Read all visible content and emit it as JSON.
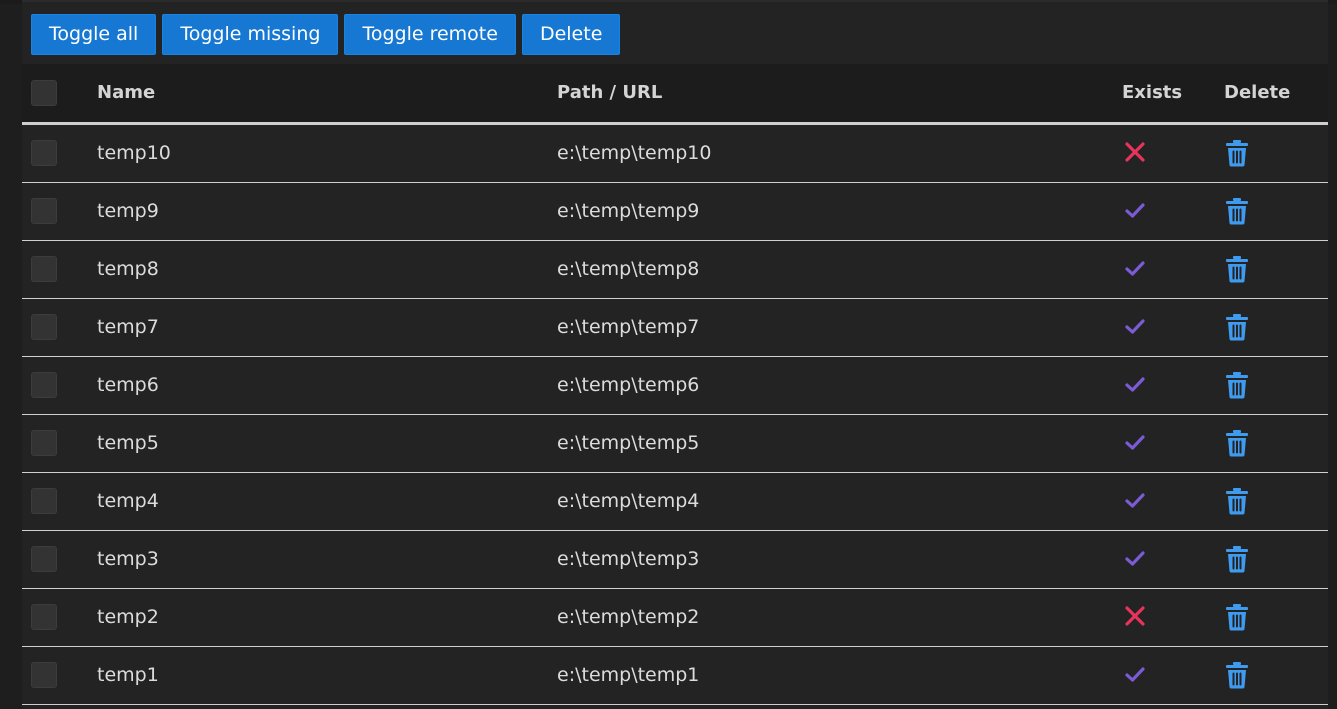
{
  "toolbar": {
    "buttons": [
      {
        "label": "Toggle all"
      },
      {
        "label": "Toggle missing"
      },
      {
        "label": "Toggle remote"
      },
      {
        "label": "Delete"
      }
    ]
  },
  "table": {
    "columns": {
      "name": "Name",
      "path": "Path / URL",
      "exists": "Exists",
      "delete": "Delete"
    },
    "rows": [
      {
        "name": "temp10",
        "path": "e:\\temp\\temp10",
        "exists": false
      },
      {
        "name": "temp9",
        "path": "e:\\temp\\temp9",
        "exists": true
      },
      {
        "name": "temp8",
        "path": "e:\\temp\\temp8",
        "exists": true
      },
      {
        "name": "temp7",
        "path": "e:\\temp\\temp7",
        "exists": true
      },
      {
        "name": "temp6",
        "path": "e:\\temp\\temp6",
        "exists": true
      },
      {
        "name": "temp5",
        "path": "e:\\temp\\temp5",
        "exists": true
      },
      {
        "name": "temp4",
        "path": "e:\\temp\\temp4",
        "exists": true
      },
      {
        "name": "temp3",
        "path": "e:\\temp\\temp3",
        "exists": true
      },
      {
        "name": "temp2",
        "path": "e:\\temp\\temp2",
        "exists": false
      },
      {
        "name": "temp1",
        "path": "e:\\temp\\temp1",
        "exists": true
      }
    ]
  },
  "icons": {
    "exists_true": "check-icon",
    "exists_false": "x-icon",
    "delete": "trash-icon"
  },
  "colors": {
    "button": "#1678d2",
    "check": "#7b5bd6",
    "cross": "#e8335a",
    "trash": "#3f9bf0"
  }
}
